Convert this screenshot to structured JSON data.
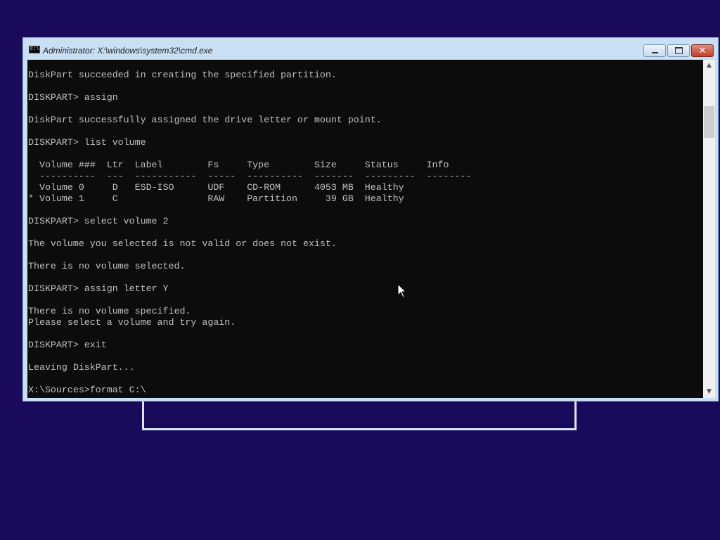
{
  "window": {
    "title": "Administrator: X:\\windows\\system32\\cmd.exe",
    "icon": "cmd-icon",
    "icon_text": "C:\\",
    "controls": {
      "minimize": "minimize-icon",
      "maximize": "maximize-icon",
      "close": "close-icon"
    }
  },
  "console": {
    "lines": [
      "DiskPart succeeded in creating the specified partition.",
      "",
      "DISKPART> assign",
      "",
      "DiskPart successfully assigned the drive letter or mount point.",
      "",
      "DISKPART> list volume",
      "",
      "  Volume ###  Ltr  Label        Fs     Type        Size     Status     Info",
      "  ----------  ---  -----------  -----  ----------  -------  ---------  --------",
      "  Volume 0     D   ESD-ISO      UDF    CD-ROM      4053 MB  Healthy",
      "* Volume 1     C                RAW    Partition     39 GB  Healthy",
      "",
      "DISKPART> select volume 2",
      "",
      "The volume you selected is not valid or does not exist.",
      "",
      "There is no volume selected.",
      "",
      "DISKPART> assign letter Y",
      "",
      "There is no volume specified.",
      "Please select a volume and try again.",
      "",
      "DISKPART> exit",
      "",
      "Leaving DiskPart...",
      "",
      "X:\\Sources>format C:\\"
    ]
  },
  "colors": {
    "desktop": "#1a0a5c",
    "console_bg": "#0c0c0c",
    "console_text": "#c0c0c0",
    "window_frame": "#c9dff3"
  }
}
